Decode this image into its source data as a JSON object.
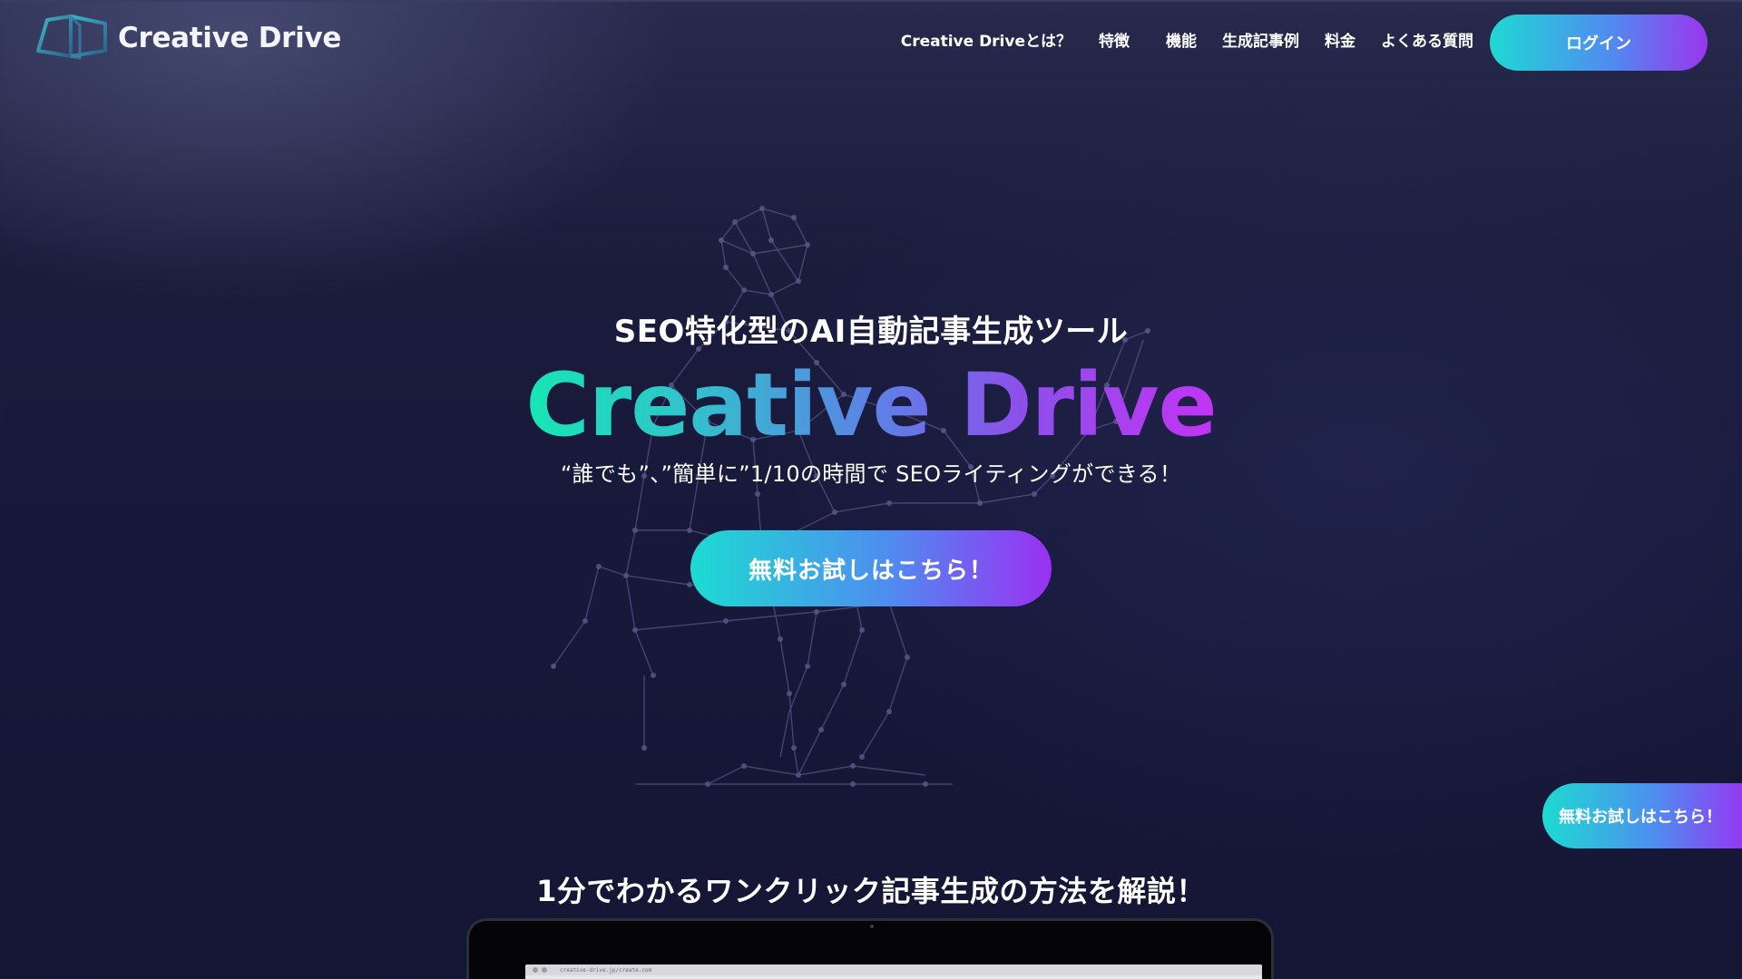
{
  "header": {
    "logo_text": "Creative Drive",
    "nav": [
      {
        "label": "Creative Driveとは？"
      },
      {
        "label": "特徴"
      },
      {
        "label": "機能"
      },
      {
        "label": "生成記事例"
      },
      {
        "label": "料金"
      },
      {
        "label": "よくある質問"
      }
    ],
    "login_label": "ログイン"
  },
  "hero": {
    "subtitle": "SEO特化型のAI自動記事生成ツール",
    "title": "Creative Drive",
    "tagline": "“誰でも”、”簡単に”1/10の時間で SEOライティングができる！",
    "cta_label": "無料お試しはこちら！"
  },
  "floating_cta": {
    "label": "無料お試しはこちら！"
  },
  "video": {
    "heading": "1分でわかるワンクリック記事生成の方法を解説！",
    "browser_url": "creative-drive.jp/create.com"
  },
  "colors": {
    "background": "#17183a",
    "gradient_start": "#1fd9d3",
    "gradient_mid": "#4f8cf0",
    "gradient_end": "#9a36ee",
    "title_gradient_end": "#c234f4"
  },
  "icons": {
    "logo": "cube-logo-icon",
    "hero_figure": "network-robot-illustration"
  }
}
